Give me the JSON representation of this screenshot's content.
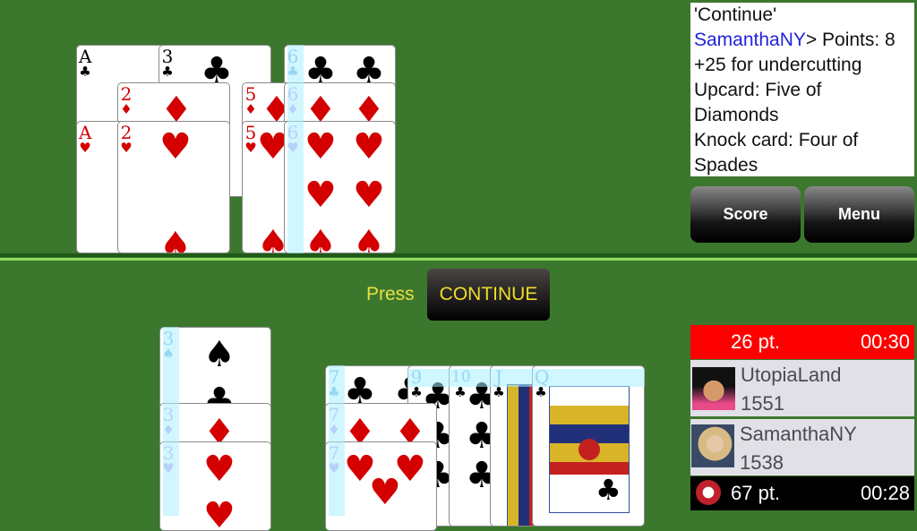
{
  "game": "Gin Rummy",
  "info_log": {
    "line1": "'Continue'",
    "player_name": "SamanthaNY",
    "points_text": ">  Points: 8",
    "line3": "+25 for undercutting",
    "line4": "Upcard: Five of",
    "line5": "Diamonds",
    "line6": "Knock card: Four of",
    "line7": "Spades"
  },
  "buttons": {
    "score": "Score",
    "menu": "Menu",
    "continue": "CONTINUE",
    "press_label": "Press"
  },
  "opponent": {
    "score": "26 pt.",
    "timer": "00:30",
    "name": "UtopiaLand",
    "rating": "1551",
    "bar_color": "#ff0000"
  },
  "player": {
    "score": "67 pt.",
    "timer": "00:28",
    "name": "SamanthaNY",
    "rating": "1538",
    "bar_color": "#000000"
  },
  "opponent_melds": [
    {
      "cards": [
        "A♣",
        "3♣",
        "2♦",
        "A♥",
        "2♥"
      ]
    },
    {
      "cards": [
        "6♣",
        "5♦",
        "6♦",
        "5♥",
        "6♥"
      ]
    }
  ],
  "player_melds": [
    {
      "cards": [
        "3♠",
        "3♦",
        "3♥"
      ]
    },
    {
      "cards": [
        "7♣",
        "7♦",
        "7♥",
        "9♣",
        "10♣",
        "J♣",
        "Q♣"
      ]
    }
  ],
  "cards": {
    "A": "A",
    "two": "2",
    "three": "3",
    "five": "5",
    "six": "6",
    "seven": "7",
    "nine": "9",
    "ten": "10",
    "J": "J",
    "Q": "Q",
    "club": "♣",
    "diamond": "♦",
    "heart": "♥",
    "spade": "♠"
  }
}
